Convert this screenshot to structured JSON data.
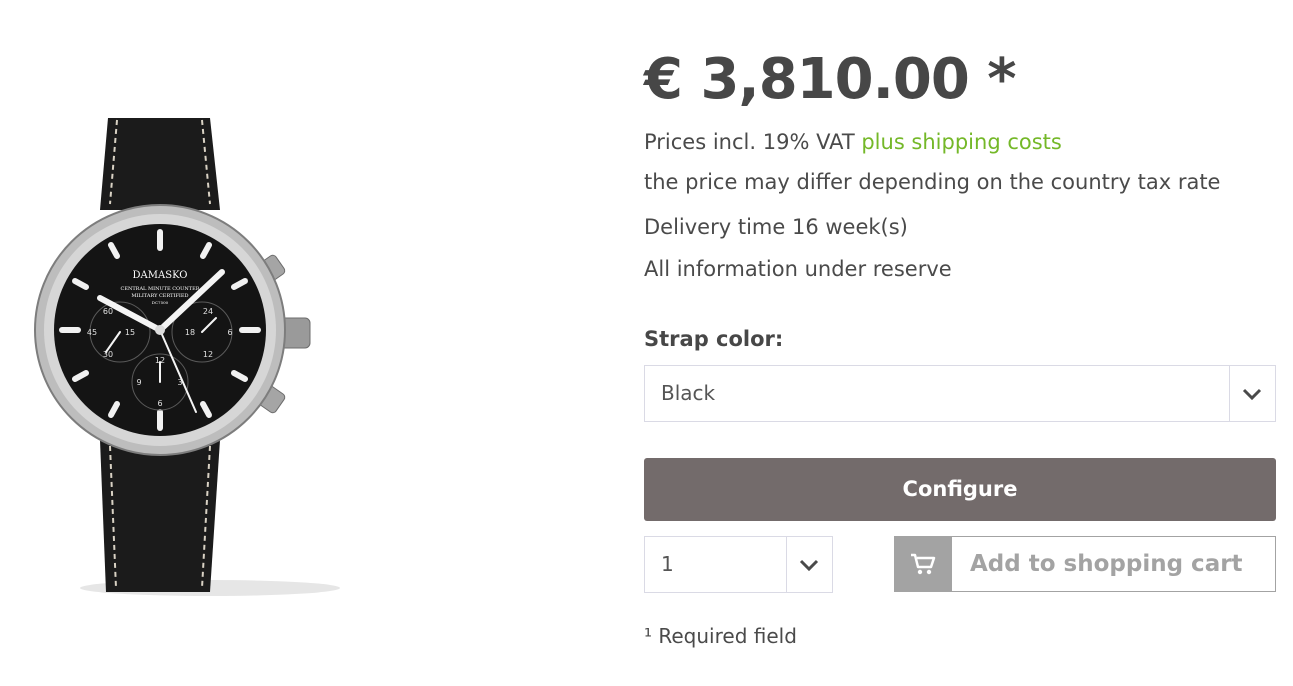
{
  "product": {
    "image_alt": "Damasko chronograph watch with black leather strap"
  },
  "watch_dial": {
    "brand": "DAMASKO",
    "line1": "CENTRAL MINUTE COUNTER",
    "line2": "MILITARY CERTIFIED",
    "line3": "DC7500",
    "subdial_left": [
      "60",
      "15",
      "45",
      "30"
    ],
    "subdial_right": [
      "24",
      "6",
      "18",
      "12"
    ],
    "subdial_bottom": [
      "12",
      "9",
      "3",
      "6"
    ]
  },
  "price": {
    "amount": "€ 3,810.00 *"
  },
  "info": {
    "vat_prefix": "Prices incl. 19% VAT",
    "shipping_link": "plus shipping costs",
    "tax_note": "the price may differ depending on the country tax rate",
    "delivery": "Delivery time 16 week(s)",
    "reserve": "All information under reserve"
  },
  "strap": {
    "label": "Strap color:",
    "selected": "Black"
  },
  "buttons": {
    "configure": "Configure",
    "add_to_cart": "Add to shopping cart"
  },
  "quantity": {
    "selected": "1"
  },
  "footer": {
    "required": "¹ Required field"
  },
  "colors": {
    "accent_green": "#74b828",
    "configure_bg": "#736b6b",
    "cart_grey": "#a3a3a3"
  },
  "icons": [
    "chevron-down-icon",
    "shopping-cart-icon"
  ]
}
